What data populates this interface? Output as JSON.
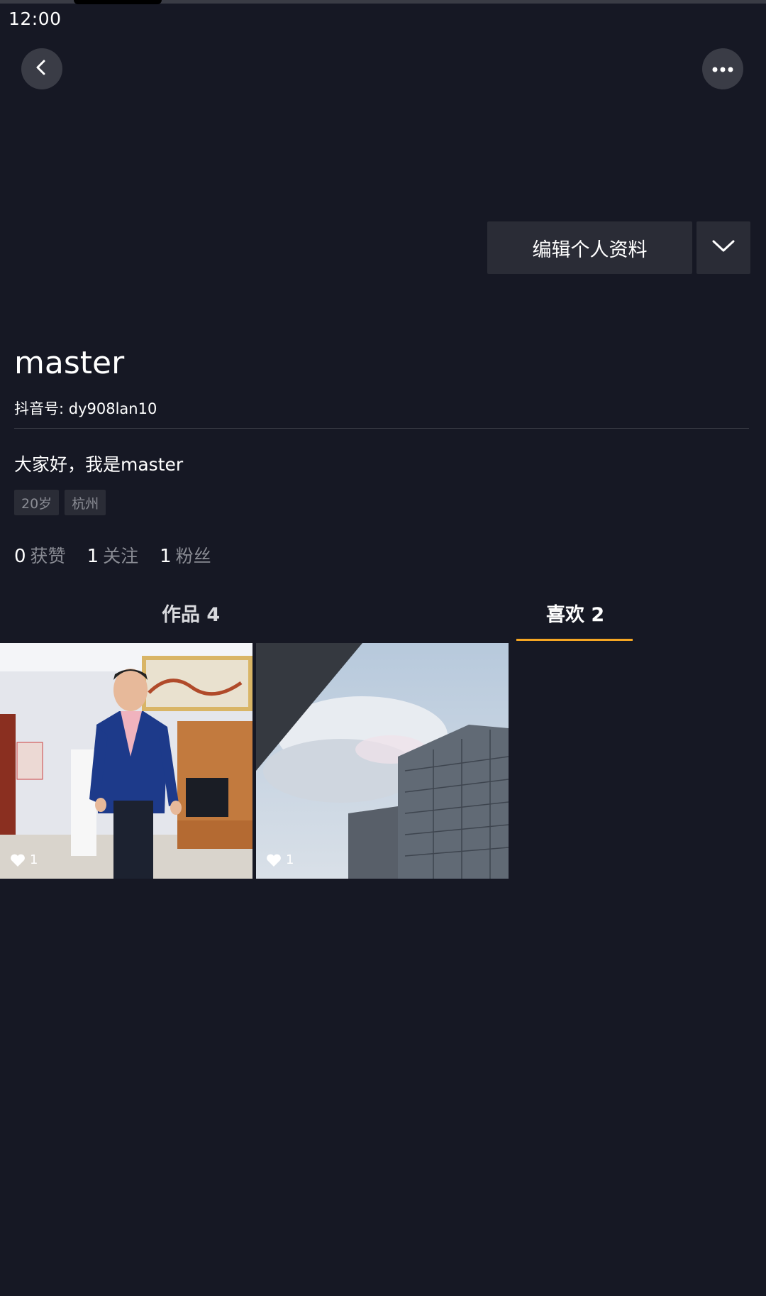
{
  "status_bar": {
    "time": "12:00"
  },
  "header": {
    "back_icon": "chevron-left-icon",
    "more_icon": "more-dots-icon"
  },
  "actions": {
    "edit_profile_label": "编辑个人资料",
    "dropdown_icon": "chevron-down-icon"
  },
  "profile": {
    "username": "master",
    "douyin_id": "抖音号: dy908lan10",
    "bio": "大家好，我是master",
    "tags": [
      "20岁",
      "杭州"
    ],
    "stats": [
      {
        "count": "0",
        "label": "获赞"
      },
      {
        "count": "1",
        "label": "关注"
      },
      {
        "count": "1",
        "label": "粉丝"
      }
    ]
  },
  "tabs": [
    {
      "label": "作品 4",
      "active": false
    },
    {
      "label": "喜欢 2",
      "active": true
    }
  ],
  "videos": [
    {
      "likes": "1",
      "scene": "man-in-blue-blazer-living-room"
    },
    {
      "likes": "1",
      "scene": "office-building-cloudy-sky"
    }
  ],
  "colors": {
    "background": "#161824",
    "button": "#2a2c36",
    "accent_underline": "#f5a623",
    "muted_text": "#8a8c94"
  }
}
